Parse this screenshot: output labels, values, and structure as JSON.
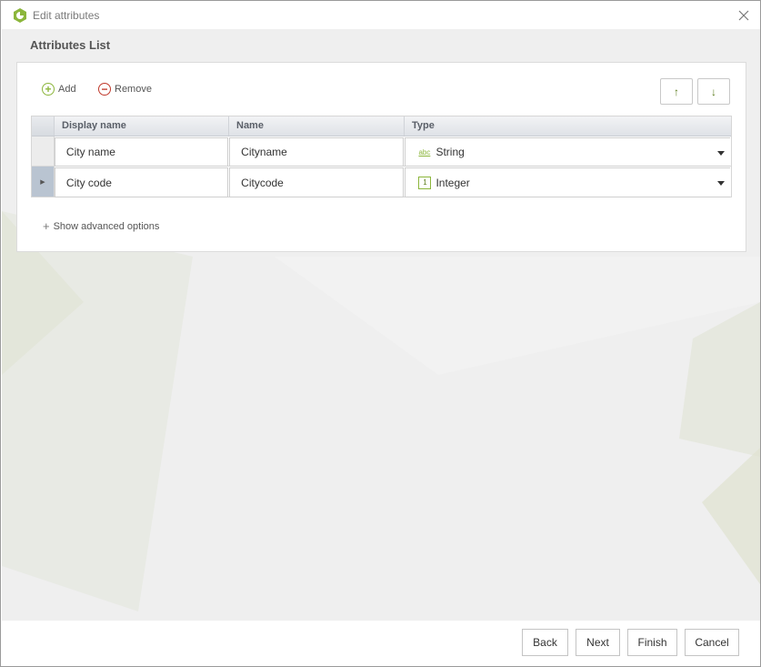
{
  "window": {
    "title": "Edit attributes"
  },
  "page": {
    "heading": "Attributes List"
  },
  "toolbar": {
    "add_label": "Add",
    "remove_label": "Remove",
    "move_up_symbol": "↑",
    "move_down_symbol": "↓"
  },
  "grid": {
    "columns": [
      "Display name",
      "Name",
      "Type"
    ],
    "rows": [
      {
        "display_name": "City name",
        "name": "Cityname",
        "type": "String",
        "type_icon": "abc-icon",
        "selected": false
      },
      {
        "display_name": "City code",
        "name": "Citycode",
        "type": "Integer",
        "type_icon": "integer-icon",
        "selected": true
      }
    ]
  },
  "advanced": {
    "label": "Show advanced options"
  },
  "footer": {
    "back": "Back",
    "next": "Next",
    "finish": "Finish",
    "cancel": "Cancel"
  },
  "colors": {
    "accent": "#8cb63c",
    "remove": "#c0392b",
    "selected_row": "#b9c4d1"
  },
  "icons": {
    "app": "app-logo-icon",
    "abc_glyph": "abc",
    "integer_glyph": "1",
    "row_pointer": "▶"
  }
}
